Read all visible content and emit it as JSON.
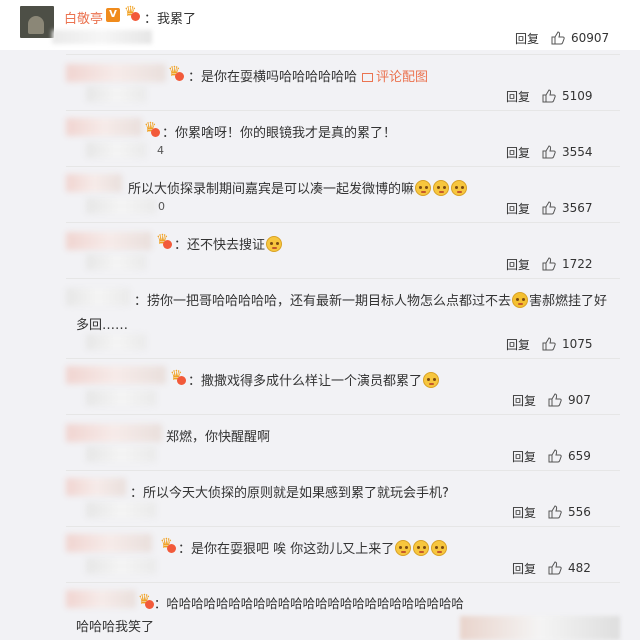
{
  "post": {
    "author": "白敬亭",
    "verified_label": "V",
    "text": "：我累了",
    "reply_label": "回复",
    "likes": "60907"
  },
  "comments": [
    {
      "text": "：是你在耍横吗哈哈哈哈哈哈",
      "pic_link": "评论配图",
      "reply": "回复",
      "likes": "5109"
    },
    {
      "text": "：你累啥呀！你的眼镜我才是真的累了！",
      "reply": "回复",
      "likes": "3554",
      "stray": "4"
    },
    {
      "text": "所以大侦探录制期间嘉宾是可以凑一起发微博的嘛",
      "reply": "回复",
      "likes": "3567",
      "stray": "0"
    },
    {
      "text": "：还不快去搜证",
      "reply": "回复",
      "likes": "1722"
    },
    {
      "text": "：捞你一把哥哈哈哈哈哈，还有最新一期目标人物怎么点都过不去",
      "text2": "害郝燃挂了好",
      "text3": "多回……",
      "reply": "回复",
      "likes": "1075"
    },
    {
      "text": "：撒撒戏得多成什么样让一个演员都累了",
      "reply": "回复",
      "likes": "907"
    },
    {
      "text": "郑燃，你快醒醒啊",
      "reply": "回复",
      "likes": "659"
    },
    {
      "text": "：所以今天大侦探的原则就是如果感到累了就玩会手机?",
      "reply": "回复",
      "likes": "556"
    },
    {
      "text": "：是你在耍狠吧 唉 你这劲儿又上来了",
      "reply": "回复",
      "likes": "482"
    },
    {
      "text": "：哈哈哈哈哈哈哈哈哈哈哈哈哈哈哈哈哈哈哈哈哈哈哈哈",
      "text2": "哈哈哈我笑了"
    }
  ],
  "colors": {
    "accent": "#eb7350",
    "background": "#f2f2f5",
    "text": "#333333"
  }
}
